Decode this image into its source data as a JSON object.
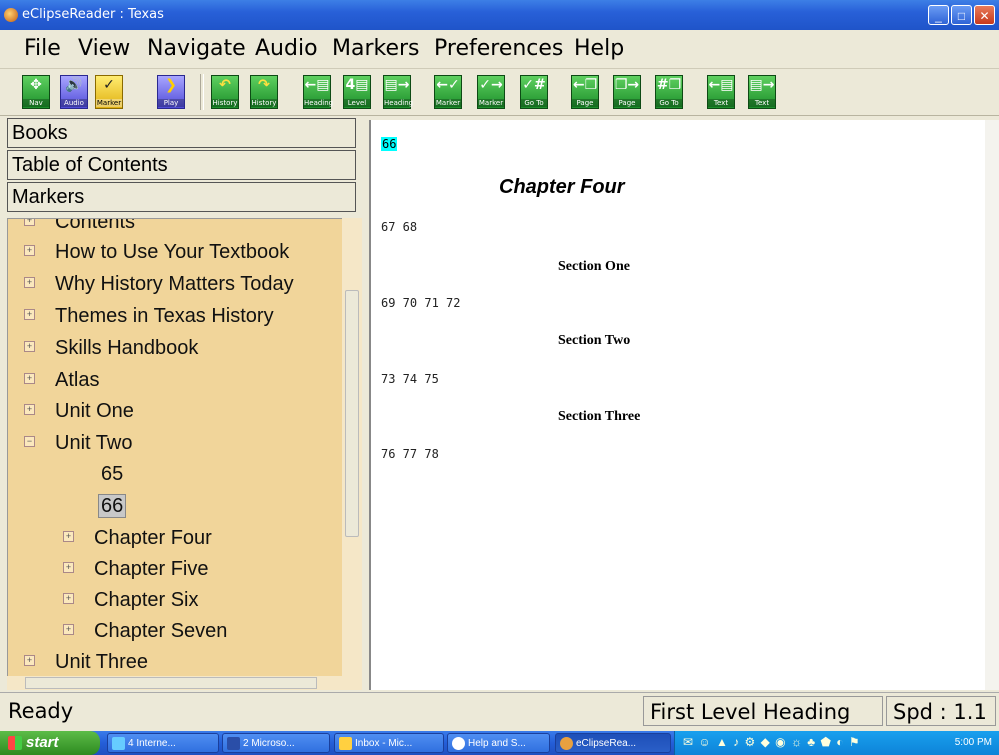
{
  "window": {
    "title": "eClipseReader : Texas"
  },
  "menu": [
    "File",
    "View",
    "Navigate",
    "Audio",
    "Markers",
    "Preferences",
    "Help"
  ],
  "toolbar": [
    {
      "name": "nav",
      "label": "Nav",
      "glyph": "✥"
    },
    {
      "name": "audio",
      "label": "Audio",
      "glyph": "🔊"
    },
    {
      "name": "marker",
      "label": "Marker",
      "glyph": "✓"
    },
    {
      "name": "play",
      "label": "Play",
      "glyph": "❯"
    },
    {
      "name": "history-back",
      "label": "History",
      "glyph": "↶"
    },
    {
      "name": "history-forward",
      "label": "History",
      "glyph": "↷"
    },
    {
      "name": "heading-prev",
      "label": "Heading",
      "glyph": "←▤"
    },
    {
      "name": "level",
      "label": "Level",
      "glyph": "4▤"
    },
    {
      "name": "heading-next",
      "label": "Heading",
      "glyph": "▤→"
    },
    {
      "name": "marker-prev",
      "label": "Marker",
      "glyph": "←✓"
    },
    {
      "name": "marker-next",
      "label": "Marker",
      "glyph": "✓→"
    },
    {
      "name": "marker-goto",
      "label": "Go To",
      "glyph": "✓#"
    },
    {
      "name": "page-prev",
      "label": "Page",
      "glyph": "←❐"
    },
    {
      "name": "page-next",
      "label": "Page",
      "glyph": "❐→"
    },
    {
      "name": "page-goto",
      "label": "Go To",
      "glyph": "#❐"
    },
    {
      "name": "text-prev",
      "label": "Text",
      "glyph": "←▤"
    },
    {
      "name": "text-next",
      "label": "Text",
      "glyph": "▤→"
    }
  ],
  "panes": {
    "books": "Books",
    "toc": "Table of Contents",
    "markers": "Markers"
  },
  "tree": [
    {
      "label": "Contents",
      "level": 0,
      "expander": "+"
    },
    {
      "label": "How to Use Your Textbook",
      "level": 0,
      "expander": "+"
    },
    {
      "label": "Why History Matters Today",
      "level": 0,
      "expander": "+"
    },
    {
      "label": "Themes in Texas History",
      "level": 0,
      "expander": "+"
    },
    {
      "label": "Skills Handbook",
      "level": 0,
      "expander": "+"
    },
    {
      "label": "Atlas",
      "level": 0,
      "expander": "+"
    },
    {
      "label": "Unit One",
      "level": 0,
      "expander": "+"
    },
    {
      "label": "Unit Two",
      "level": 0,
      "expander": "−"
    },
    {
      "label": "65",
      "level": 1,
      "expander": ""
    },
    {
      "label": "66",
      "level": 1,
      "expander": "",
      "selected": true
    },
    {
      "label": "Chapter Four",
      "level": 1,
      "expander": "+"
    },
    {
      "label": "Chapter Five",
      "level": 1,
      "expander": "+"
    },
    {
      "label": "Chapter Six",
      "level": 1,
      "expander": "+"
    },
    {
      "label": "Chapter Seven",
      "level": 1,
      "expander": "+"
    },
    {
      "label": "Unit Three",
      "level": 0,
      "expander": "+"
    }
  ],
  "content": {
    "current_page": "66",
    "chapter_title": "Chapter Four",
    "pages_1": "67 68",
    "section_1": "Section One",
    "pages_2": "69 70 71 72",
    "section_2": "Section Two",
    "pages_3": "73 74 75",
    "section_3": "Section Three",
    "pages_4": "76 77 78"
  },
  "status": {
    "state": "Ready",
    "mode": "First Level Heading",
    "speed": "Spd : 1.1"
  },
  "taskbar": {
    "start": "start",
    "tasks": [
      {
        "label": "4 Interne...",
        "active": false
      },
      {
        "label": "2 Microso...",
        "active": false
      },
      {
        "label": "Inbox - Mic...",
        "active": false
      },
      {
        "label": "Help and S...",
        "active": false
      },
      {
        "label": "eClipseRea...",
        "active": true
      }
    ],
    "clock": "5:00 PM"
  },
  "colors": {
    "tree_bg": "#f1d59a",
    "page_highlight": "#00ffff",
    "titlebar": "#2860d8"
  }
}
